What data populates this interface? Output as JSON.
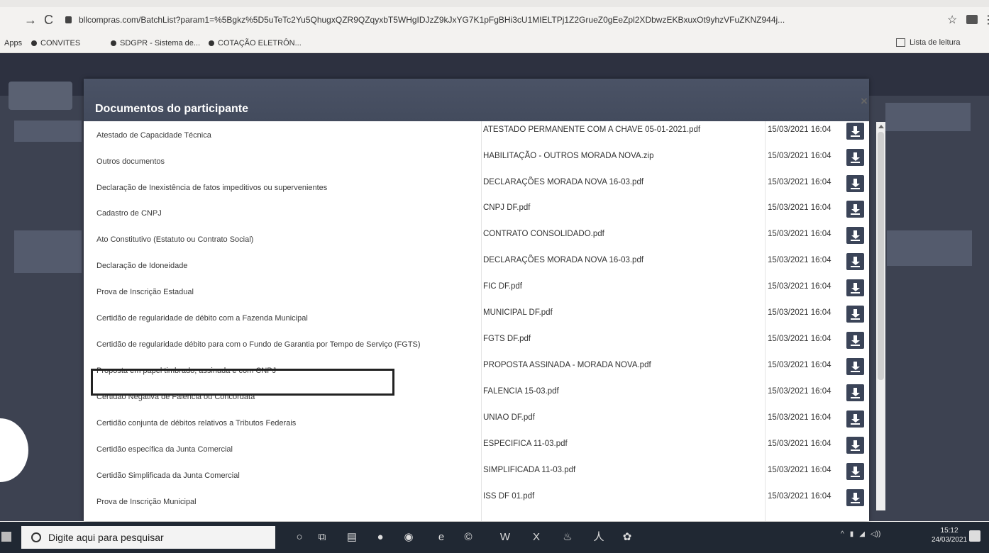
{
  "browser": {
    "url": "bllcompras.com/BatchList?param1=%5Bgkz%5D5uTeTc2Yu5QhugxQZR9QZqyxbT5WHgIDJzZ9kJxYG7K1pFgBHi3cU1MIELTPj1Z2GrueZ0gEeZpl2XDbwzEKBxuxOt9yhzVFuZKNZ944j...",
    "bookmarks": [
      "Apps",
      "CONVITES",
      "SDGPR - Sistema de...",
      "COTAÇÃO ELETRÔN..."
    ],
    "reading_list": "Lista de leitura"
  },
  "modal": {
    "title": "Documentos do participante",
    "close": "×",
    "rows": [
      {
        "doc": "Atestado de Capacidade Técnica",
        "file": "ATESTADO PERMANENTE COM A CHAVE 05-01-2021.pdf",
        "date": "15/03/2021 16:04"
      },
      {
        "doc": "Outros documentos",
        "file": "HABILITAÇÃO - OUTROS MORADA NOVA.zip",
        "date": "15/03/2021 16:04"
      },
      {
        "doc": "Declaração de Inexistência de fatos impeditivos ou supervenientes",
        "file": "DECLARAÇÕES MORADA NOVA 16-03.pdf",
        "date": "15/03/2021 16:04"
      },
      {
        "doc": "Cadastro de CNPJ",
        "file": "CNPJ DF.pdf",
        "date": "15/03/2021 16:04"
      },
      {
        "doc": "Ato Constitutivo (Estatuto ou Contrato Social)",
        "file": "CONTRATO CONSOLIDADO.pdf",
        "date": "15/03/2021 16:04"
      },
      {
        "doc": "Declaração de Idoneidade",
        "file": "DECLARAÇÕES MORADA NOVA 16-03.pdf",
        "date": "15/03/2021 16:04"
      },
      {
        "doc": "Prova de Inscrição Estadual",
        "file": "FIC DF.pdf",
        "date": "15/03/2021 16:04"
      },
      {
        "doc": "Certidão de regularidade de débito com a Fazenda Municipal",
        "file": "MUNICIPAL DF.pdf",
        "date": "15/03/2021 16:04"
      },
      {
        "doc": "Certidão de regularidade débito para com o Fundo de Garantia por Tempo de Serviço (FGTS)",
        "file": "FGTS DF.pdf",
        "date": "15/03/2021 16:04"
      },
      {
        "doc": "Proposta em papel timbrado, assinada e com CNPJ",
        "file": "PROPOSTA ASSINADA - MORADA NOVA.pdf",
        "date": "15/03/2021 16:04"
      },
      {
        "doc": "Certidão Negativa de Falência ou Concordata",
        "file": "FALENCIA 15-03.pdf",
        "date": "15/03/2021 16:04"
      },
      {
        "doc": "Certidão conjunta de débitos relativos a Tributos Federais",
        "file": "UNIAO DF.pdf",
        "date": "15/03/2021 16:04"
      },
      {
        "doc": "Certidão específica da Junta Comercial",
        "file": "ESPECIFICA 11-03.pdf",
        "date": "15/03/2021 16:04"
      },
      {
        "doc": "Certidão Simplificada da Junta Comercial",
        "file": "SIMPLIFICADA 11-03.pdf",
        "date": "15/03/2021 16:04"
      },
      {
        "doc": "Prova de Inscrição Municipal",
        "file": "ISS DF 01.pdf",
        "date": "15/03/2021 16:04"
      }
    ]
  },
  "taskbar": {
    "search_placeholder": "Digite aqui para pesquisar",
    "time": "15:12",
    "date": "24/03/2021"
  },
  "colors": {
    "modal_header": "#474f62",
    "download_button": "#3b4458",
    "taskbar": "#202833"
  }
}
